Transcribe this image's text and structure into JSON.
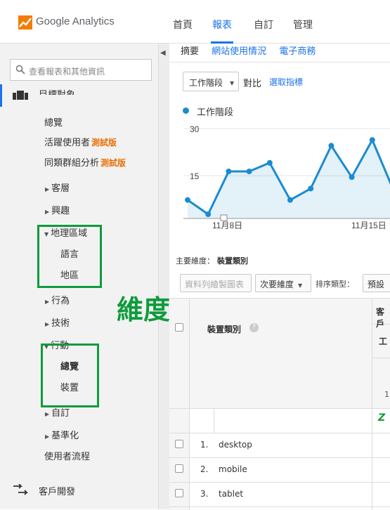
{
  "app": {
    "name": "Google Analytics",
    "nav": [
      "首頁",
      "報表",
      "自訂",
      "管理"
    ],
    "nav_active": "報表"
  },
  "sidebar": {
    "search_placeholder": "查看報表和其他資訊",
    "section_title": "目標對象",
    "items": {
      "overview": "總覽",
      "active_users": "活躍使用者",
      "active_users_badge": "測試版",
      "cohort": "同類群組分析",
      "cohort_badge": "測試版",
      "demographics": "客層",
      "interests": "興趣",
      "geo": "地理區域",
      "geo_language": "語言",
      "geo_location": "地區",
      "behavior": "行為",
      "technology": "技術",
      "mobile": "行動",
      "mobile_overview": "總覽",
      "mobile_devices": "裝置",
      "custom": "自訂",
      "benchmarking": "基準化",
      "user_flow": "使用者流程",
      "acquisition": "客戶開發"
    },
    "annotation": "維度"
  },
  "main": {
    "subtabs": [
      "摘要",
      "網站使用情況",
      "電子商務"
    ],
    "metric_selector": "工作階段",
    "compare_label": "對比",
    "select_metric": "選取指標",
    "legend": "工作階段",
    "primary_dimension_label": "主要維度：",
    "primary_dimension_value": "裝置類別",
    "plot_rows": "資料列繪製圖表",
    "secondary_dimension": "次要維度",
    "sort_type_label": "排序類型：",
    "sort_default": "預設",
    "table": {
      "header": "裝置類別",
      "acq_header": "客戶",
      "acq_sub": "工",
      "total_hint": "1",
      "rows": [
        {
          "num": "1.",
          "label": "desktop"
        },
        {
          "num": "2.",
          "label": "mobile"
        },
        {
          "num": "3.",
          "label": "tablet"
        }
      ]
    }
  },
  "chart_data": {
    "type": "area",
    "series": [
      {
        "name": "工作階段",
        "color": "#1a8bd1",
        "values": [
          5,
          0,
          15,
          15,
          18,
          5,
          9,
          24,
          13,
          26,
          9
        ]
      }
    ],
    "x_tick_labels": [
      "11月8日",
      "11月15日"
    ],
    "y_tick_labels": [
      "30",
      "15"
    ],
    "ylim": [
      0,
      30
    ]
  }
}
